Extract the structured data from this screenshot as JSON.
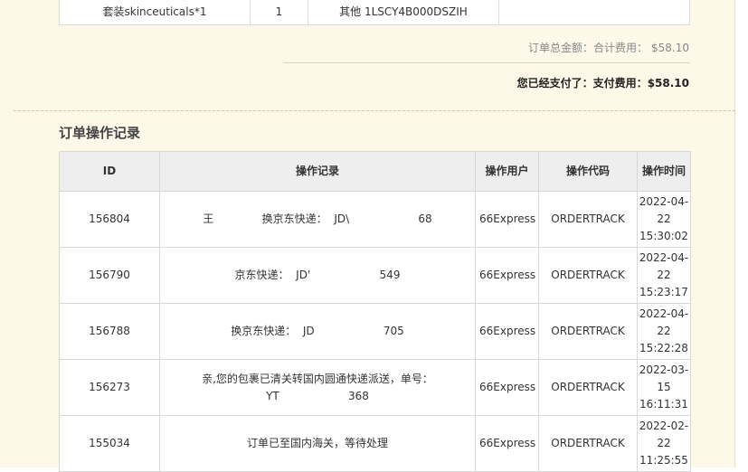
{
  "items": {
    "row": {
      "name": "套装skinceuticals*1",
      "qty": "1",
      "code": "其他 1LSCY4B000DSZIH",
      "extra": ""
    }
  },
  "summary": {
    "total_label": "订单总金额：合计费用：",
    "total_amount": "$58.10",
    "paid_label": "您已经支付了：支付费用：",
    "paid_amount": "$58.10"
  },
  "log": {
    "title": "订单操作记录",
    "headers": {
      "id": "ID",
      "record": "操作记录",
      "user": "操作用户",
      "code": "操作代码",
      "time": "操作时间"
    },
    "rows": [
      {
        "id": "156804",
        "record": "王              换京东快递：  JD\\                    68",
        "user": "66Express",
        "code": "ORDERTRACK",
        "time": "2022-04-22 15:30:02"
      },
      {
        "id": "156790",
        "record": "京东快递：  JD'                    549",
        "user": "66Express",
        "code": "ORDERTRACK",
        "time": "2022-04-22 15:23:17"
      },
      {
        "id": "156788",
        "record": "换京东快递：  JD                    705",
        "user": "66Express",
        "code": "ORDERTRACK",
        "time": "2022-04-22 15:22:28"
      },
      {
        "id": "156273",
        "record": "亲,您的包裹已清关转国内圆通快递派送，单号：\nYT                    368",
        "user": "66Express",
        "code": "ORDERTRACK",
        "time": "2022-03-15 16:11:31"
      },
      {
        "id": "155034",
        "record": "订单已至国内海关，等待处理",
        "user": "66Express",
        "code": "ORDERTRACK",
        "time": "2022-02-22 11:25:55"
      }
    ]
  }
}
